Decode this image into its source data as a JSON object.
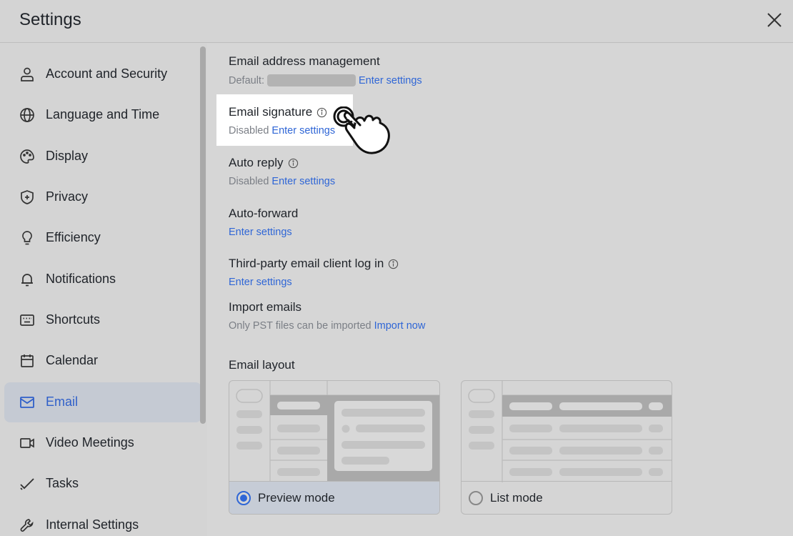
{
  "window": {
    "title": "Settings"
  },
  "sidebar": {
    "items": [
      {
        "label": "Account and Security",
        "icon": "person-icon"
      },
      {
        "label": "Language and Time",
        "icon": "globe-icon"
      },
      {
        "label": "Display",
        "icon": "palette-icon"
      },
      {
        "label": "Privacy",
        "icon": "shield-icon"
      },
      {
        "label": "Efficiency",
        "icon": "lightbulb-icon"
      },
      {
        "label": "Notifications",
        "icon": "bell-icon"
      },
      {
        "label": "Shortcuts",
        "icon": "keyboard-icon"
      },
      {
        "label": "Calendar",
        "icon": "calendar-icon"
      },
      {
        "label": "Email",
        "icon": "mail-icon",
        "active": true
      },
      {
        "label": "Video Meetings",
        "icon": "video-icon"
      },
      {
        "label": "Tasks",
        "icon": "check-icon"
      },
      {
        "label": "Internal Settings",
        "icon": "wrench-icon"
      }
    ]
  },
  "email": {
    "address": {
      "title": "Email address management",
      "default_label": "Default:",
      "link": "Enter settings"
    },
    "signature": {
      "title": "Email signature",
      "status": "Disabled",
      "link": "Enter settings"
    },
    "auto_reply": {
      "title": "Auto reply",
      "status": "Disabled",
      "link": "Enter settings"
    },
    "auto_forward": {
      "title": "Auto-forward",
      "link": "Enter settings"
    },
    "third_party": {
      "title": "Third-party email client log in",
      "link": "Enter settings"
    },
    "import": {
      "title": "Import emails",
      "note": "Only PST files can be imported",
      "link": "Import now"
    },
    "layout": {
      "title": "Email layout",
      "options": [
        {
          "label": "Preview mode",
          "selected": true
        },
        {
          "label": "List mode",
          "selected": false
        }
      ]
    }
  },
  "colors": {
    "accent": "#2f66d6",
    "active_bg": "#c5cad3",
    "background": "#d4d4d4"
  }
}
